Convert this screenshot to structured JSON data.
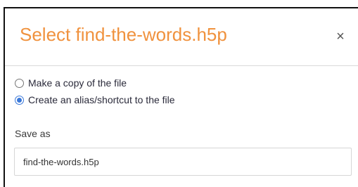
{
  "dialog": {
    "title": "Select find-the-words.h5p",
    "close_glyph": "×",
    "close_icon": "close-icon"
  },
  "options": [
    {
      "label": "Make a copy of the file",
      "checked": false
    },
    {
      "label": "Create an alias/shortcut to the file",
      "checked": true
    }
  ],
  "save_as": {
    "label": "Save as",
    "value": "find-the-words.h5p"
  },
  "colors": {
    "title": "#f0923e",
    "radio_selected": "#3a78d9"
  }
}
